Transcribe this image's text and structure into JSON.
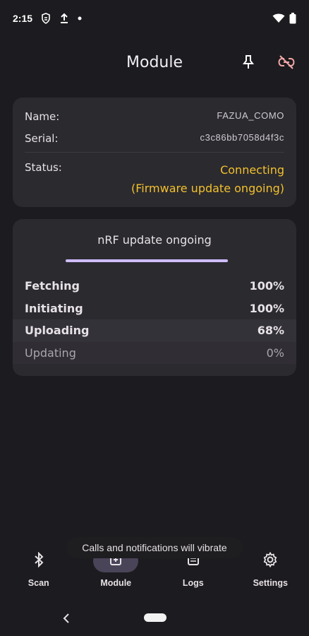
{
  "status_bar": {
    "time": "2:15",
    "icons": [
      "data-saver-icon",
      "upload-icon",
      "notification-dot-icon",
      "wifi-icon",
      "battery-icon"
    ]
  },
  "top_bar": {
    "title": "Module",
    "actions": [
      {
        "icon": "pin-icon",
        "color": "#ffffff"
      },
      {
        "icon": "link-off-icon",
        "color": "#f2a7a7"
      }
    ]
  },
  "module_info": {
    "name_label": "Name:",
    "name_value": "FAZUA_COMO",
    "serial_label": "Serial:",
    "serial_value": "c3c86bb7058d4f3c",
    "status_label": "Status:",
    "status_value": "Connecting",
    "status_detail": "(Firmware update ongoing)",
    "status_color": "#f2c02c"
  },
  "update": {
    "title": "nRF update ongoing",
    "progress": 1.0,
    "progress_color": "#cfbcff",
    "stages": [
      {
        "label": "Fetching",
        "value": "100%",
        "state": "done"
      },
      {
        "label": "Initiating",
        "value": "100%",
        "state": "done"
      },
      {
        "label": "Uploading",
        "value": "68%",
        "state": "active"
      },
      {
        "label": "Updating",
        "value": "0%",
        "state": "pending"
      }
    ]
  },
  "toast": {
    "text": "Calls and notifications will vibrate"
  },
  "bottom_nav": {
    "items": [
      {
        "label": "Scan",
        "icon": "bluetooth-icon",
        "active": false
      },
      {
        "label": "Module",
        "icon": "module-icon",
        "active": true
      },
      {
        "label": "Logs",
        "icon": "logs-icon",
        "active": false
      },
      {
        "label": "Settings",
        "icon": "gear-icon",
        "active": false
      }
    ]
  }
}
